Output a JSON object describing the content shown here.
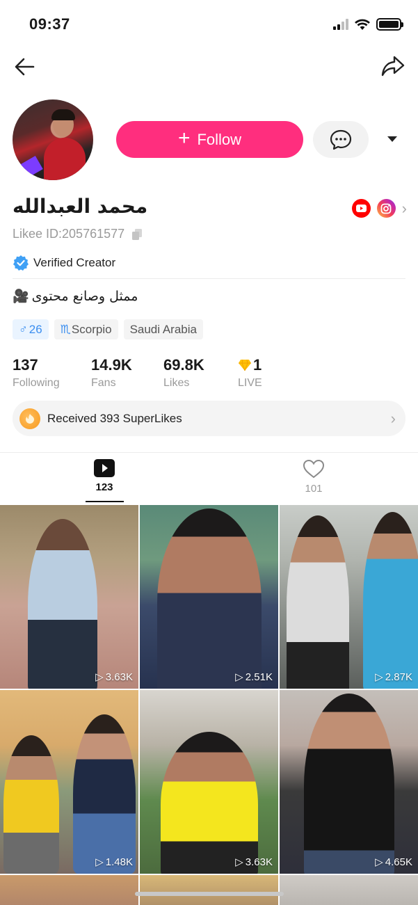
{
  "status_bar": {
    "time": "09:37"
  },
  "profile": {
    "name": "محمد العبدالله",
    "likee_id": "Likee ID:205761577",
    "verified_label": "Verified Creator",
    "bio": "ممثل وصانع محتوى",
    "bio_emoji": "🎥",
    "tags": {
      "gender_age": "26",
      "zodiac": "Scorpio",
      "country": "Saudi Arabia"
    },
    "follow_label": "Follow"
  },
  "stats": [
    {
      "value": "137",
      "label": "Following"
    },
    {
      "value": "14.9K",
      "label": "Fans"
    },
    {
      "value": "69.8K",
      "label": "Likes"
    },
    {
      "value": "1",
      "label": "LIVE"
    }
  ],
  "superlikes": {
    "label": "Received 393 SuperLikes"
  },
  "tabs": [
    {
      "name": "videos",
      "count": "123",
      "icon": "play-icon",
      "active": true
    },
    {
      "name": "likes",
      "count": "101",
      "icon": "heart-icon",
      "active": false
    }
  ],
  "videos": [
    {
      "views": "3.63K"
    },
    {
      "views": "2.51K"
    },
    {
      "views": "2.87K"
    },
    {
      "views": "1.48K"
    },
    {
      "views": "3.63K"
    },
    {
      "views": "4.65K"
    }
  ],
  "colors": {
    "accent": "#ff2e7e",
    "youtube": "#ff0000",
    "gender": "#3b8ef0"
  }
}
